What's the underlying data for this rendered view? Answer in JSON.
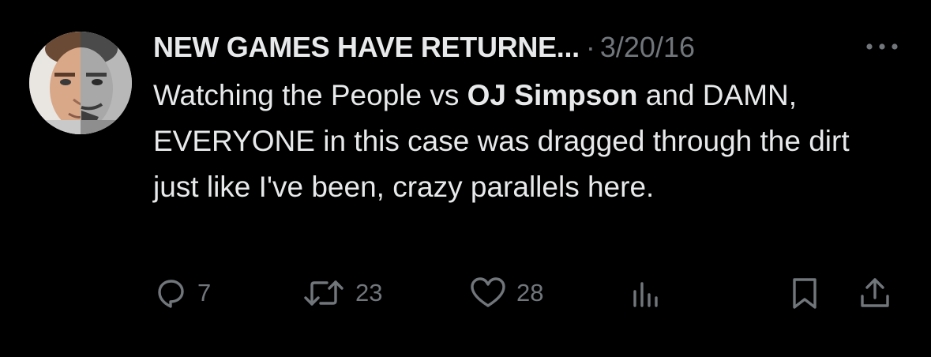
{
  "tweet": {
    "author": "NEW GAMES HAVE RETURNE...",
    "separator": "·",
    "date": "3/20/16",
    "text_before": "Watching the People vs ",
    "text_bold": "OJ Simpson",
    "text_after": " and DAMN, EVERYONE in this case was dragged through the dirt just like I've been, crazy parallels here."
  },
  "actions": {
    "replies": "7",
    "retweets": "23",
    "likes": "28"
  },
  "icons": {
    "more": "more-icon",
    "reply": "reply-icon",
    "retweet": "retweet-icon",
    "like": "heart-icon",
    "views": "views-icon",
    "bookmark": "bookmark-icon",
    "share": "share-icon"
  },
  "colors": {
    "background": "#000000",
    "text": "#e7e9ea",
    "muted": "#71767b"
  }
}
